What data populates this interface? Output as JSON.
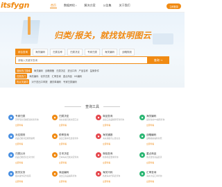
{
  "header": {
    "logo": "itsfygn",
    "nav": [
      {
        "label": "首页",
        "active": true
      },
      {
        "label": "数据库检",
        "active": false,
        "caret": true
      },
      {
        "label": "解决方案",
        "active": false
      },
      {
        "label": "公告集",
        "active": false
      },
      {
        "label": "关于我们",
        "active": false
      }
    ],
    "cta": "立即登录"
  },
  "hero": {
    "title": "归类/报关，就找钛明图云",
    "tabs": [
      "综合查询",
      "海关编码",
      "归类名称",
      "归类决定",
      "专家归类",
      "海关编码",
      "战略规划",
      "战略储备"
    ],
    "active_tab_index": 0,
    "search_placeholder": "请输入关键字查询",
    "search_button": "查询",
    "hot_rows": [
      {
        "label": "搜索热门搜索",
        "items": [
          "海关编码",
          "战略储备",
          "归类决定",
          "进出口商",
          "产品名称",
          "监管条件",
          "税率查询"
        ]
      },
      {
        "label": "归类热门",
        "items": [
          "海关编码",
          "化学归类",
          "汇率查询",
          "重点商品",
          "HS编码",
          "战略编码"
        ]
      },
      {
        "label": "热点关键词",
        "items": [
          "对于进出口申报",
          "通关单编码",
          "专家归类编码"
        ]
      }
    ]
  },
  "section": {
    "title": "查询工具"
  },
  "tools": [
    {
      "name": "专家归类",
      "desc": "历年专家归类结论检索查询",
      "link": "立即查看",
      "color": "#4a90e2",
      "icon": "user-icon"
    },
    {
      "name": "归类决定",
      "desc": "海关总署归类决定汇总",
      "link": "立即查看",
      "color": "#f08a13",
      "icon": "doc-icon"
    },
    {
      "name": "商品查询",
      "desc": "进出口商品税则号列查询",
      "link": "立即查看",
      "color": "#e5484d",
      "icon": "search-icon"
    },
    {
      "name": "海关编码",
      "desc": "最新海关HS编码查询",
      "link": "立即查看",
      "color": "#2bb673",
      "icon": "code-icon"
    },
    {
      "name": "对应规则",
      "desc": "商品归类对应规则说明",
      "link": "立即查看",
      "color": "#4a90e2",
      "icon": "rule-icon"
    },
    {
      "name": "税率查询",
      "desc": "进出口税率及监管条件",
      "link": "立即查看",
      "color": "#f08a13",
      "icon": "tax-icon"
    },
    {
      "name": "海关通报",
      "desc": "海关通报与公告信息",
      "link": "立即查看",
      "color": "#e5484d",
      "icon": "bell-icon"
    },
    {
      "name": "战略编码",
      "desc": "战略物资编码对照",
      "link": "立即查看",
      "color": "#2bb673",
      "icon": "shield-icon"
    },
    {
      "name": "归类比对",
      "desc": "商品归类结论比对分析",
      "link": "立即查看",
      "color": "#4a90e2",
      "icon": "compare-icon"
    },
    {
      "name": "日本决定",
      "desc": "日本海关归类决定查询",
      "link": "立即查看",
      "color": "#f08a13",
      "icon": "flag-icon"
    },
    {
      "name": "商检查询",
      "desc": "检验检疫要求查询",
      "link": "立即查看",
      "color": "#e5484d",
      "icon": "check-icon"
    },
    {
      "name": "重点商品",
      "desc": "重点监管商品目录",
      "link": "立即查看",
      "color": "#2bb673",
      "icon": "star-icon"
    },
    {
      "name": "报关实务",
      "desc": "报关操作实务指南",
      "link": "立即查看",
      "color": "#4a90e2",
      "icon": "book-icon"
    },
    {
      "name": "商品编码",
      "desc": "进出口商品编码查询",
      "link": "立即查看",
      "color": "#f08a13",
      "icon": "tag-icon"
    },
    {
      "name": "海关代码",
      "desc": "各类海关代码表查询",
      "link": "立即查看",
      "color": "#e5484d",
      "icon": "list-icon"
    },
    {
      "name": "汇率查询",
      "desc": "海关计征汇率查询",
      "link": "立即查看",
      "color": "#2bb673",
      "icon": "money-icon"
    }
  ]
}
